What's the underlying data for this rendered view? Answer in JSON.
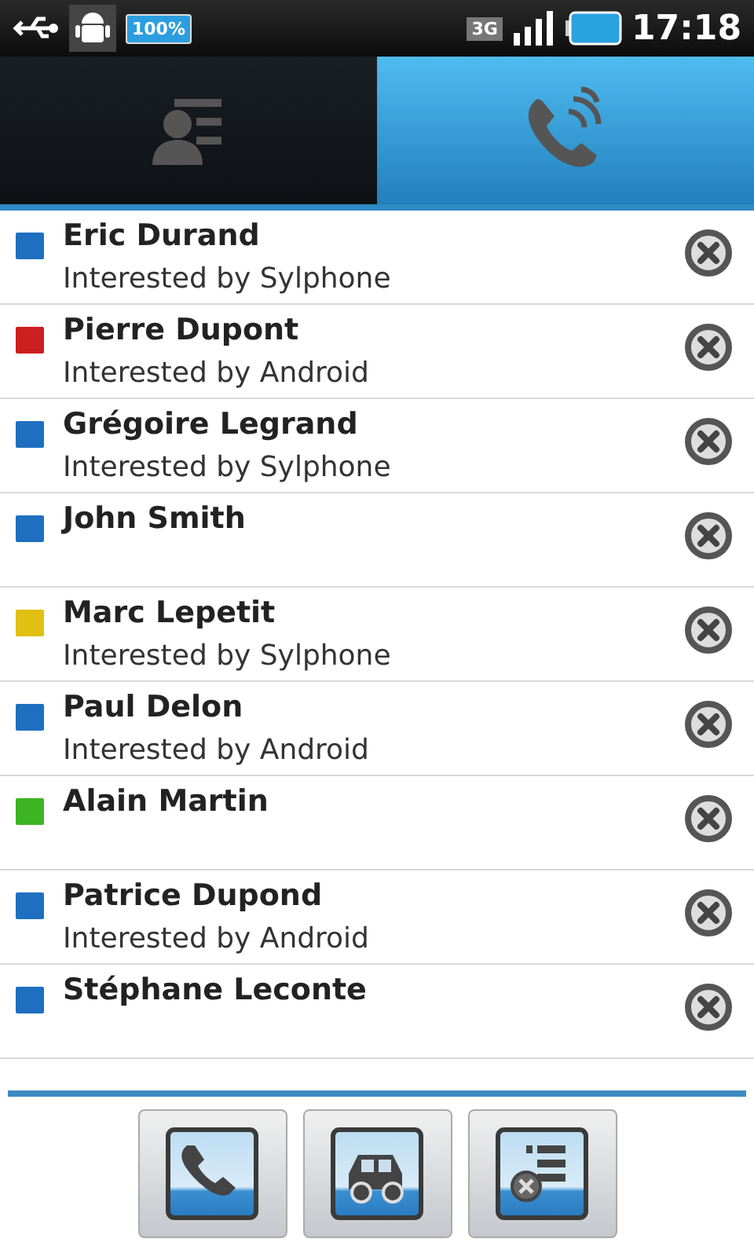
{
  "status_bar": {
    "battery_badge": "100%",
    "network": "3G",
    "time": "17:18"
  },
  "tabs": [
    {
      "kind": "contacts",
      "selected": false
    },
    {
      "kind": "calls",
      "selected": true
    }
  ],
  "contacts": [
    {
      "name": "Eric Durand",
      "subtitle": "Interested by Sylphone",
      "color": "#1e6fc0"
    },
    {
      "name": "Pierre Dupont",
      "subtitle": "Interested by Android",
      "color": "#cc1f1f"
    },
    {
      "name": "Grégoire Legrand",
      "subtitle": "Interested by Sylphone",
      "color": "#1e6fc0"
    },
    {
      "name": "John Smith",
      "color": "#1e6fc0"
    },
    {
      "name": "Marc Lepetit",
      "subtitle": "Interested by Sylphone",
      "color": "#e0c010"
    },
    {
      "name": "Paul Delon",
      "subtitle": "Interested by Android",
      "color": "#1e6fc0"
    },
    {
      "name": "Alain Martin",
      "color": "#3cb521"
    },
    {
      "name": "Patrice Dupond",
      "subtitle": "Interested by Android",
      "color": "#1e6fc0"
    },
    {
      "name": "Stéphane Leconte",
      "color": "#1e6fc0"
    }
  ],
  "actions": [
    {
      "kind": "call"
    },
    {
      "kind": "car"
    },
    {
      "kind": "remove-list"
    }
  ]
}
